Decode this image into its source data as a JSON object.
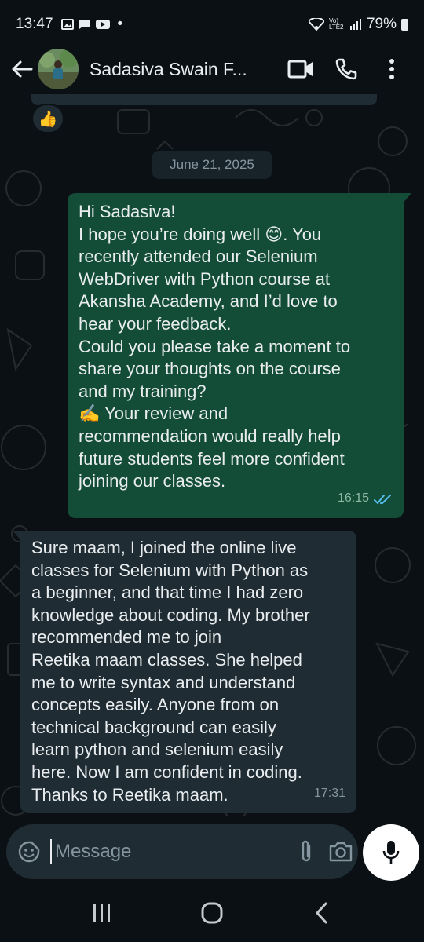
{
  "status_bar": {
    "time": "13:47",
    "dot": "•",
    "network": "Vo) LTE2",
    "battery_text": "79%",
    "icons": [
      "image-icon",
      "message-icon",
      "youtube-icon",
      "wifi-icon",
      "signal-icon",
      "battery-icon"
    ]
  },
  "header": {
    "contact_name": "Sadasiva Swain F...",
    "icons": [
      "back-arrow-icon",
      "video-call-icon",
      "phone-icon",
      "more-vertical-icon"
    ]
  },
  "chat": {
    "reaction_emoji": "👍",
    "date_chip": "June 21, 2025",
    "outgoing": {
      "lines": [
        "Hi Sadasiva!",
        "I hope you’re doing well",
        "😊",
        ". You",
        "recently attended our Selenium",
        "WebDriver with Python course at",
        "Akansha Academy, and I’d love to",
        "hear your feedback.",
        "Could you please take a moment to",
        "share your thoughts on the course",
        "and my training?",
        "✍️",
        " Your review and",
        "recommendation would really help",
        "future students feel more confident",
        "joining our classes."
      ],
      "time": "16:15",
      "status_icon": "double-check-icon",
      "status_color": "#53bdeb"
    },
    "incoming": {
      "lines": [
        "Sure maam, I joined the online live",
        "classes for Selenium with Python as",
        "a beginner, and that time I had zero",
        "knowledge about coding. My brother",
        "recommended me to join",
        "Reetika maam classes. She helped",
        "me to write syntax and understand",
        "concepts easily. Anyone from on",
        "technical background can easily",
        "learn python and selenium easily",
        "here. Now I am confident in coding.",
        "Thanks to Reetika maam."
      ],
      "time": "17:31"
    }
  },
  "input": {
    "placeholder": "Message",
    "icons": [
      "sticker-icon",
      "attach-icon",
      "camera-icon",
      "mic-icon"
    ]
  },
  "nav": {
    "icons": [
      "recent-apps-icon",
      "home-icon",
      "back-icon"
    ]
  },
  "colors": {
    "background": "#0b1014",
    "outgoing_bubble": "#144d37",
    "incoming_bubble": "#1f2c33",
    "read_ticks": "#53bdeb",
    "text": "#e9edef",
    "secondary_text": "#8696a0"
  }
}
